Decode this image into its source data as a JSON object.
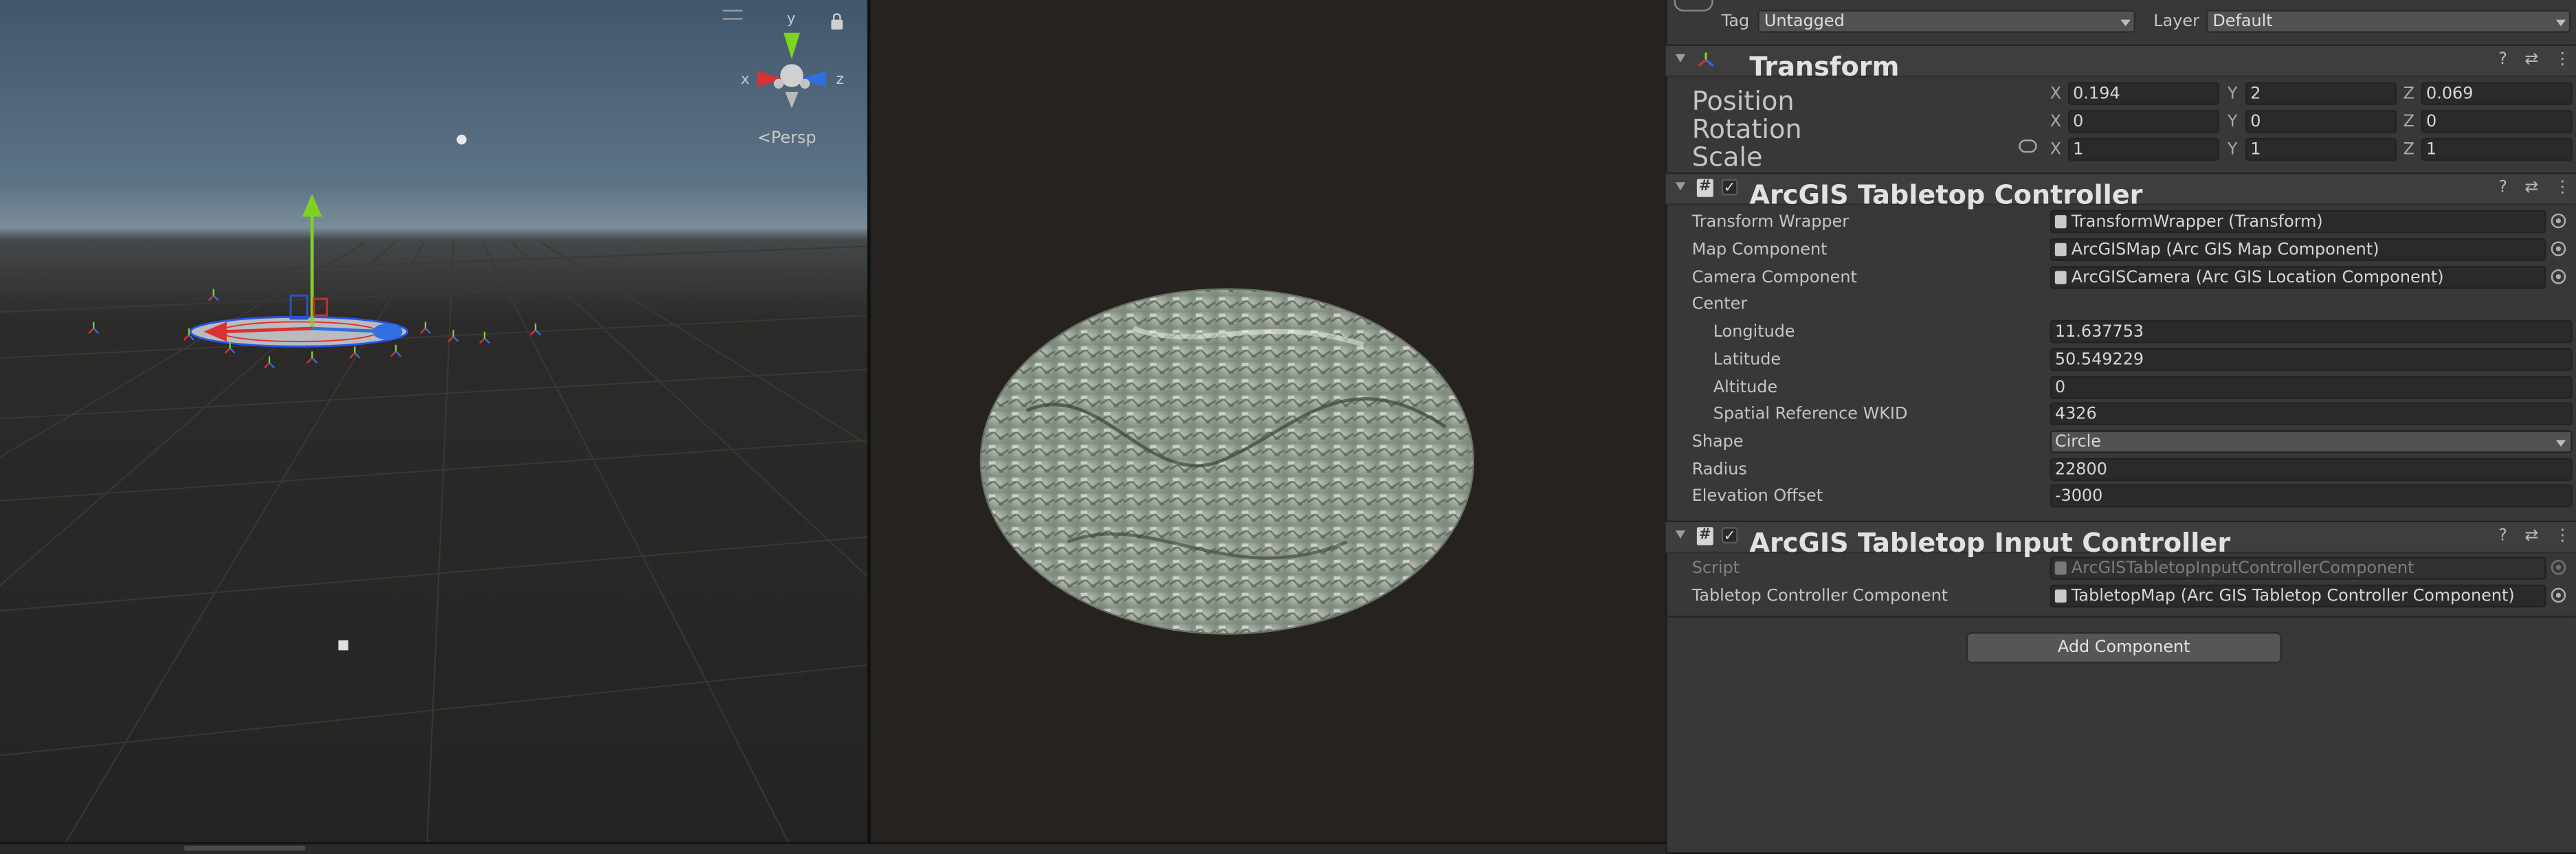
{
  "scene_view": {
    "projection_label": "Persp",
    "gizmo_axes": {
      "y": "y",
      "x": "x",
      "z": "z"
    },
    "icons": [
      "lock-icon",
      "menu-lines-icon",
      "light-icon",
      "camera-icon"
    ]
  },
  "inspector": {
    "tag_label": "Tag",
    "tag_value": "Untagged",
    "layer_label": "Layer",
    "layer_value": "Default",
    "transform": {
      "title": "Transform",
      "position_label": "Position",
      "rotation_label": "Rotation",
      "scale_label": "Scale",
      "axis_x": "X",
      "axis_y": "Y",
      "axis_z": "Z",
      "position": {
        "x": "0.194",
        "y": "2",
        "z": "0.069"
      },
      "rotation": {
        "x": "0",
        "y": "0",
        "z": "0"
      },
      "scale": {
        "x": "1",
        "y": "1",
        "z": "1"
      }
    },
    "tabletop_controller": {
      "title": "ArcGIS Tabletop Controller",
      "enabled_mark": "✓",
      "transform_wrapper_label": "Transform Wrapper",
      "transform_wrapper_value": "TransformWrapper (Transform)",
      "map_component_label": "Map Component",
      "map_component_value": "ArcGISMap (Arc GIS Map Component)",
      "camera_component_label": "Camera Component",
      "camera_component_value": "ArcGISCamera (Arc GIS Location Component)",
      "center_label": "Center",
      "longitude_label": "Longitude",
      "longitude_value": "11.637753",
      "latitude_label": "Latitude",
      "latitude_value": "50.549229",
      "altitude_label": "Altitude",
      "altitude_value": "0",
      "wkid_label": "Spatial Reference WKID",
      "wkid_value": "4326",
      "shape_label": "Shape",
      "shape_value": "Circle",
      "radius_label": "Radius",
      "radius_value": "22800",
      "elevation_label": "Elevation Offset",
      "elevation_value": "-3000"
    },
    "tabletop_input_controller": {
      "title": "ArcGIS Tabletop Input Controller",
      "enabled_mark": "✓",
      "script_label": "Script",
      "script_value": "ArcGISTabletopInputControllerComponent",
      "tabletop_component_label": "Tabletop Controller Component",
      "tabletop_component_value": "TabletopMap (Arc GIS Tabletop Controller Component)"
    },
    "header_buttons": {
      "help": "?",
      "settings": "⇄",
      "more": "⋮"
    },
    "add_component_label": "Add Component"
  },
  "colors": {
    "axis_x": "#d83232",
    "axis_y": "#7ed321",
    "axis_z": "#2f6fe0",
    "panel": "#383838",
    "field": "#2a2a2a"
  }
}
